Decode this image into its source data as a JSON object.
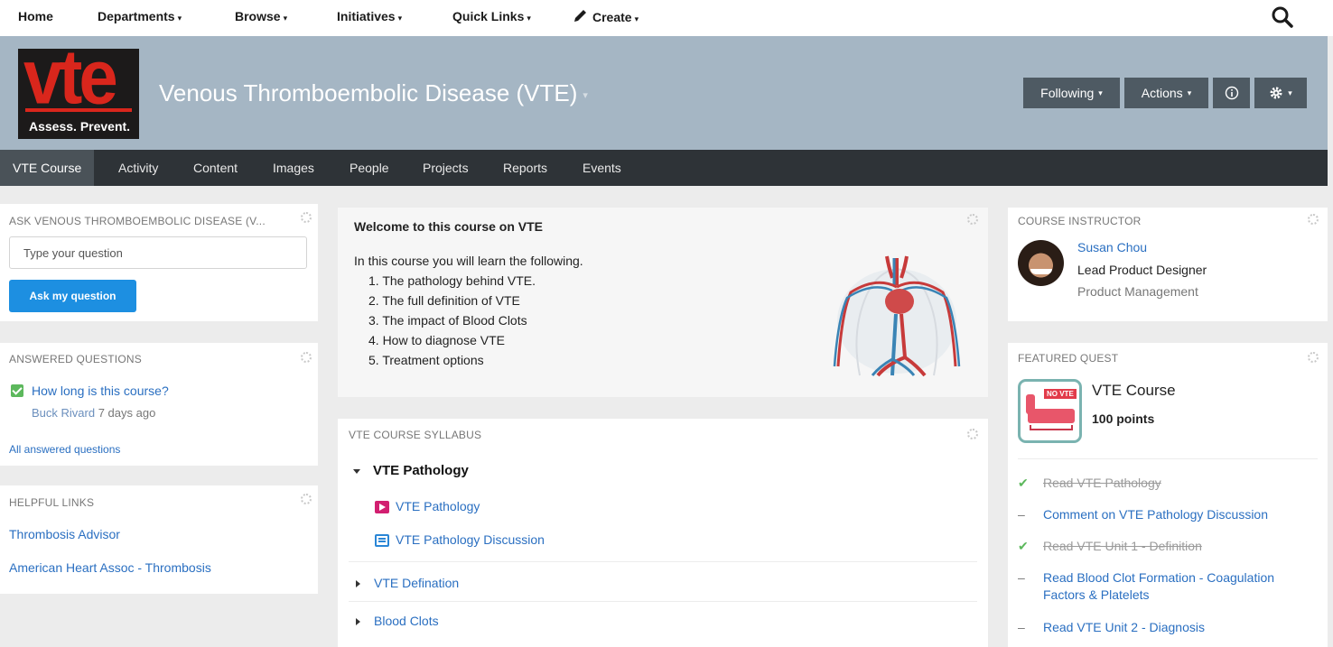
{
  "topnav": {
    "items": [
      {
        "label": "Home",
        "has_menu": false
      },
      {
        "label": "Departments",
        "has_menu": true
      },
      {
        "label": "Browse",
        "has_menu": true
      },
      {
        "label": "Initiatives",
        "has_menu": true
      },
      {
        "label": "Quick Links",
        "has_menu": true
      },
      {
        "label": "Create",
        "has_menu": true,
        "icon": "pencil-icon"
      }
    ],
    "search_icon": "search-icon"
  },
  "banner": {
    "logo": {
      "big": "vte",
      "tagline": "Assess. Prevent."
    },
    "title": "Venous Thromboembolic Disease (VTE)",
    "buttons": {
      "following": "Following",
      "actions": "Actions",
      "info_icon": "info-icon",
      "settings_icon": "gear-icon"
    },
    "background_color": "#a5b6c4"
  },
  "tabs": [
    {
      "label": "VTE Course",
      "active": true
    },
    {
      "label": "Activity",
      "active": false
    },
    {
      "label": "Content",
      "active": false
    },
    {
      "label": "Images",
      "active": false
    },
    {
      "label": "People",
      "active": false
    },
    {
      "label": "Projects",
      "active": false
    },
    {
      "label": "Reports",
      "active": false
    },
    {
      "label": "Events",
      "active": false
    }
  ],
  "ask": {
    "header": "ASK VENOUS THROMBOEMBOLIC DISEASE (V...",
    "placeholder": "Type your question",
    "button": "Ask my question"
  },
  "answered": {
    "header": "ANSWERED QUESTIONS",
    "items": [
      {
        "question": "How long is this course?",
        "author": "Buck Rivard",
        "time": "7 days ago"
      }
    ],
    "all_link": "All answered questions"
  },
  "helpful_links": {
    "header": "HELPFUL LINKS",
    "items": [
      "Thrombosis Advisor",
      "American Heart Assoc - Thrombosis"
    ]
  },
  "welcome": {
    "title": "Welcome to this course on VTE",
    "intro": "In this course you will learn the following.",
    "list": [
      "1. The pathology behind VTE.",
      "2. The full definition of VTE",
      "3. The impact of Blood Clots",
      "4. How to diagnose VTE",
      "5. Treatment options"
    ]
  },
  "syllabus": {
    "header": "VTE COURSE SYLLABUS",
    "sections": [
      {
        "title": "VTE Pathology",
        "expanded": true,
        "items": [
          {
            "label": "VTE Pathology",
            "icon": "video-icon"
          },
          {
            "label": "VTE Pathology Discussion",
            "icon": "discussion-icon"
          }
        ]
      },
      {
        "title": "VTE Defination",
        "expanded": false
      },
      {
        "title": "Blood Clots",
        "expanded": false
      }
    ]
  },
  "instructor": {
    "header": "COURSE INSTRUCTOR",
    "name": "Susan Chou",
    "role": "Lead Product Designer",
    "department": "Product Management"
  },
  "quest": {
    "header": "FEATURED QUEST",
    "badge_label": "NO VTE",
    "title": "VTE Course",
    "points": "100 points",
    "tasks": [
      {
        "label": "Read VTE Pathology",
        "done": true
      },
      {
        "label": "Comment on VTE Pathology Discussion",
        "done": false
      },
      {
        "label": "Read VTE Unit 1 - Definition",
        "done": true
      },
      {
        "label": "Read Blood Clot Formation - Coagulation Factors & Platelets",
        "done": false
      },
      {
        "label": "Read VTE Unit 2 - Diagnosis",
        "done": false
      }
    ],
    "done_mark": "✔",
    "todo_mark": "–"
  },
  "colors": {
    "link": "#2a6fc1",
    "ask_button": "#1d8fe1",
    "tabbar": "#2e3337",
    "check": "#5cb85c"
  }
}
